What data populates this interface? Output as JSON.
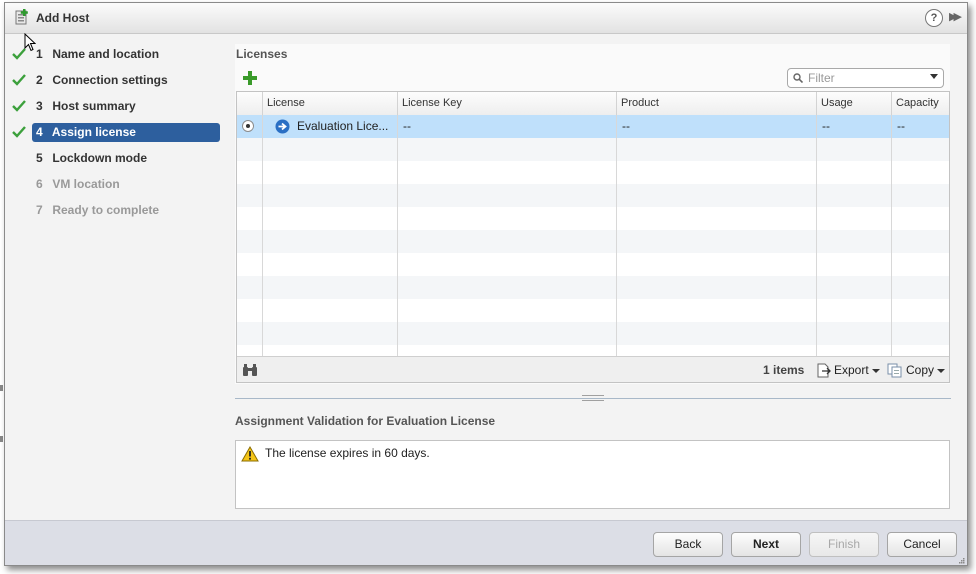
{
  "window": {
    "title": "Add Host"
  },
  "steps": [
    {
      "num": "1",
      "label": "Name and location",
      "done": true,
      "state": "normal"
    },
    {
      "num": "2",
      "label": "Connection settings",
      "done": true,
      "state": "normal"
    },
    {
      "num": "3",
      "label": "Host summary",
      "done": true,
      "state": "normal"
    },
    {
      "num": "4",
      "label": "Assign license",
      "done": true,
      "state": "active"
    },
    {
      "num": "5",
      "label": "Lockdown mode",
      "done": false,
      "state": "normal"
    },
    {
      "num": "6",
      "label": "VM location",
      "done": false,
      "state": "disabled"
    },
    {
      "num": "7",
      "label": "Ready to complete",
      "done": false,
      "state": "disabled"
    }
  ],
  "licenses": {
    "title": "Licenses",
    "filter_placeholder": "Filter",
    "columns": [
      "License",
      "License Key",
      "Product",
      "Usage",
      "Capacity"
    ],
    "rows": [
      {
        "license": "Evaluation Lice...",
        "key": "--",
        "product": "--",
        "usage": "--",
        "capacity": "--",
        "selected": true
      }
    ],
    "item_count": "1 items",
    "export_label": "Export",
    "copy_label": "Copy"
  },
  "validation": {
    "title": "Assignment Validation for Evaluation License",
    "message": "The license expires in 60 days."
  },
  "buttons": {
    "back": "Back",
    "next": "Next",
    "finish": "Finish",
    "cancel": "Cancel"
  },
  "colors": {
    "active_step": "#2d5f9e",
    "check": "#3ca03c",
    "selected_row": "#bfe0fb",
    "footer": "#dcdee6"
  }
}
